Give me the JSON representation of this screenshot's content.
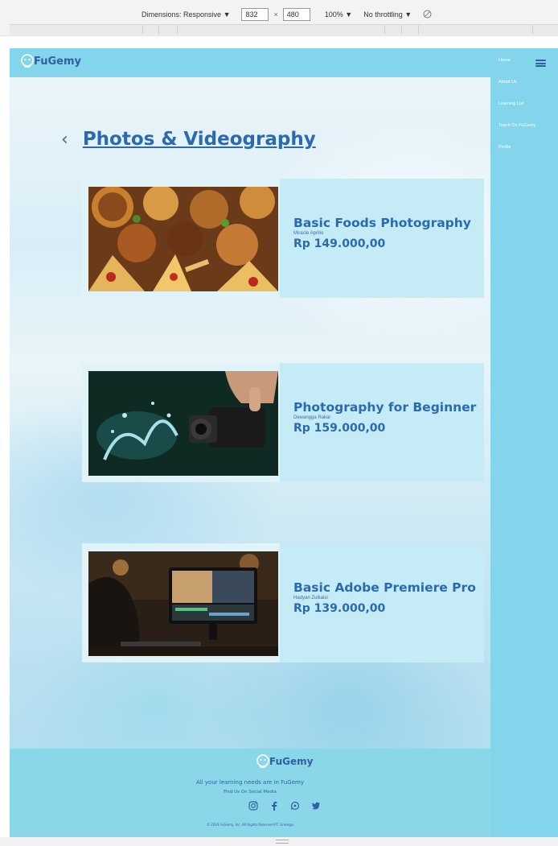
{
  "devtools": {
    "dimensions_label": "Dimensions: Responsive",
    "width_value": "832",
    "times": "×",
    "height_value": "480",
    "zoom": "100%",
    "throttling": "No throttling",
    "dropdown_arrow": "▼"
  },
  "brand": {
    "name": "FuGemy"
  },
  "nav": {
    "items": [
      {
        "label": "Home"
      },
      {
        "label": "About Us"
      },
      {
        "label": "Learning List"
      },
      {
        "label": "Teach On FuGemy"
      },
      {
        "label": "Profile"
      }
    ]
  },
  "page": {
    "back_icon": "‹",
    "title": "Photos & Videography"
  },
  "courses": [
    {
      "title": "Basic Foods Photography",
      "author": "Miracle Aprilio",
      "price": "Rp 149.000,00",
      "image": "food-photo"
    },
    {
      "title": "Photography for Beginner",
      "author": "Dewangga Rakai",
      "price": "Rp 159.000,00",
      "image": "camera-splash-photo"
    },
    {
      "title": "Basic Adobe Premiere Pro",
      "author": "Hadyan Zulkaisi",
      "price": "Rp 139.000,00",
      "image": "video-editing-photo"
    }
  ],
  "footer": {
    "tagline": "All your learning needs are in FuGemy",
    "find_us": "Find Us On Social Media",
    "social": [
      "instagram-icon",
      "facebook-icon",
      "whatsapp-icon",
      "twitter-icon"
    ],
    "copyright": "© 2019 FuGemy, Inc. All Rights Reserved PT. Greekgo"
  },
  "colors": {
    "accent": "#82d5ea",
    "primary_text": "#2a6ab0",
    "card_bg": "#c4ebf6"
  }
}
